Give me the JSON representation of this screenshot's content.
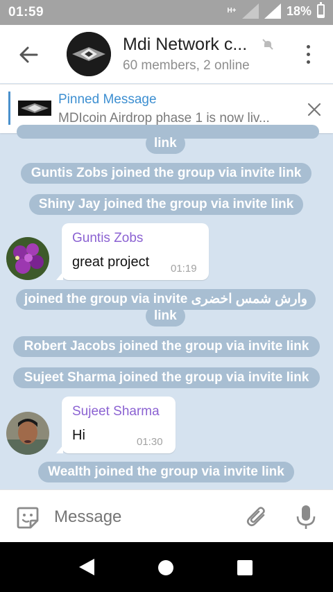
{
  "status_bar": {
    "time": "01:59",
    "network": "H+",
    "battery": "18%",
    "battery_level": 0.18
  },
  "header": {
    "title": "Mdi Network c...",
    "subtitle": "60 members, 2 online"
  },
  "pinned": {
    "title": "Pinned Message",
    "text": "MDIcoin Airdrop phase 1 is now liv..."
  },
  "messages": {
    "service_top_tail": "link",
    "service_1": "Guntis Zobs joined the group via invite link",
    "service_2": "Shiny Jay joined the group via invite link",
    "bubble_1": {
      "sender": "Guntis Zobs",
      "text": "great project",
      "time": "01:19"
    },
    "service_3_line1": "وارش شمس اخضری joined the group via invite",
    "service_3_line2": "link",
    "service_4": "Robert Jacobs joined the group via invite link",
    "service_5": "Sujeet Sharma joined the group via invite link",
    "bubble_2": {
      "sender": "Sujeet Sharma",
      "text": "Hi",
      "time": "01:30"
    },
    "service_6": "Wealth joined the group via invite link"
  },
  "input": {
    "placeholder": "Message"
  },
  "colors": {
    "chat_bg": "#d5e2ef",
    "service_bg": "#a8bed2",
    "accent_blue": "#3d8fd1",
    "sender_name": "#8b62d2"
  }
}
